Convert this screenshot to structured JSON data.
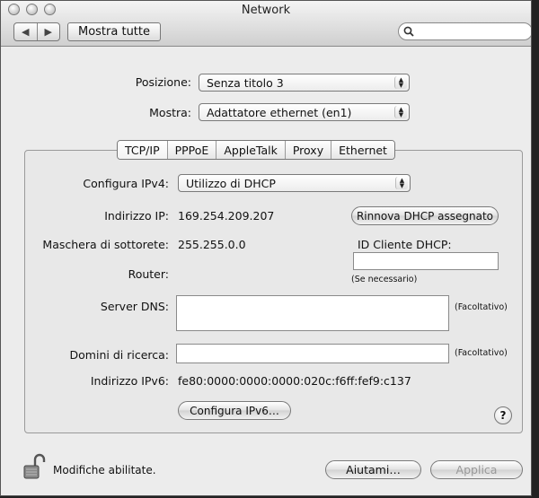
{
  "window": {
    "title": "Network"
  },
  "toolbar": {
    "back_glyph": "◀",
    "forward_glyph": "▶",
    "show_all_label": "Mostra tutte",
    "search_placeholder": ""
  },
  "location": {
    "label": "Posizione:",
    "value": "Senza titolo 3"
  },
  "show": {
    "label": "Mostra:",
    "value": "Adattatore ethernet (en1)"
  },
  "tabs": [
    {
      "label": "TCP/IP",
      "active": true
    },
    {
      "label": "PPPoE",
      "active": false
    },
    {
      "label": "AppleTalk",
      "active": false
    },
    {
      "label": "Proxy",
      "active": false
    },
    {
      "label": "Ethernet",
      "active": false
    }
  ],
  "tcpip": {
    "configure_ipv4_label": "Configura IPv4:",
    "configure_ipv4_value": "Utilizzo di DHCP",
    "ip_label": "Indirizzo IP:",
    "ip_value": "169.254.209.207",
    "renew_button": "Rinnova DHCP assegnato",
    "subnet_label": "Maschera di sottorete:",
    "subnet_value": "255.255.0.0",
    "dhcp_client_id_label": "ID Cliente DHCP:",
    "dhcp_client_id_value": "",
    "if_needed": "(Se necessario)",
    "router_label": "Router:",
    "router_value": "",
    "dns_label": "Server DNS:",
    "dns_value": "",
    "optional_1": "(Facoltativo)",
    "search_domains_label": "Domini di ricerca:",
    "search_domains_value": "",
    "optional_2": "(Facoltativo)",
    "ipv6_label": "Indirizzo IPv6:",
    "ipv6_value": "fe80:0000:0000:0000:020c:f6ff:fef9:c137",
    "configure_ipv6_button": "Configura IPv6…",
    "help_glyph": "?"
  },
  "footer": {
    "lock_status": "Modifiche abilitate.",
    "help_button": "Aiutami…",
    "apply_button": "Applica"
  }
}
